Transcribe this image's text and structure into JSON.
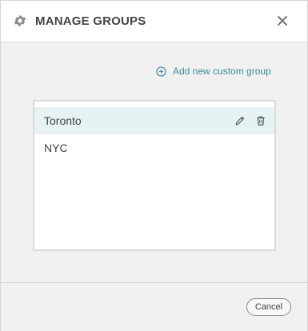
{
  "header": {
    "title": "MANAGE GROUPS",
    "icon": "gear-icon",
    "close_icon": "close-icon"
  },
  "actions": {
    "add_label": "Add new custom group",
    "add_icon": "plus-circle-icon"
  },
  "groups": [
    {
      "name": "Toronto",
      "selected": true,
      "edit_icon": "pencil-icon",
      "delete_icon": "trash-icon"
    },
    {
      "name": "NYC",
      "selected": false
    }
  ],
  "footer": {
    "cancel_label": "Cancel"
  },
  "colors": {
    "accent": "#3a8c9c",
    "selected_row": "#e6f2f4",
    "dialog_bg": "#f1f1f1"
  }
}
